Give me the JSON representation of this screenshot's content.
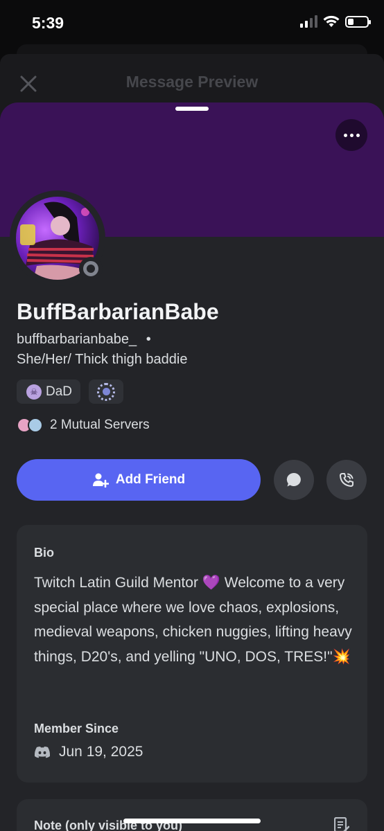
{
  "status_bar": {
    "time": "5:39",
    "battery_level": 0.3
  },
  "header": {
    "title": "Message Preview",
    "close_icon": "close-icon"
  },
  "profile": {
    "banner_color": "#3a1257",
    "display_name": "BuffBarbarianBabe",
    "username": "buffbarbarianbabe_",
    "separator": "•",
    "pronouns": "She/Her/ Thick thigh baddie",
    "status": "offline",
    "badges": [
      {
        "label": "DaD",
        "icon": "skull-icon"
      },
      {
        "label": "",
        "icon": "laurel-badge-icon"
      }
    ],
    "mutual_servers_label": "2 Mutual Servers"
  },
  "actions": {
    "add_friend_label": "Add Friend",
    "message_icon": "chat-bubble-icon",
    "call_icon": "phone-call-icon",
    "accent": "#5865f2"
  },
  "bio": {
    "heading": "Bio",
    "text": "Twitch Latin Guild Mentor 💜 Welcome to a very special place where we love chaos, explosions, medieval weapons, chicken nuggies, lifting heavy things, D20's, and yelling \"UNO, DOS, TRES!\"💥",
    "member_since_heading": "Member Since",
    "member_since_date": "Jun 19, 2025"
  },
  "note": {
    "label": "Note (only visible to you)",
    "icon": "note-edit-icon"
  }
}
